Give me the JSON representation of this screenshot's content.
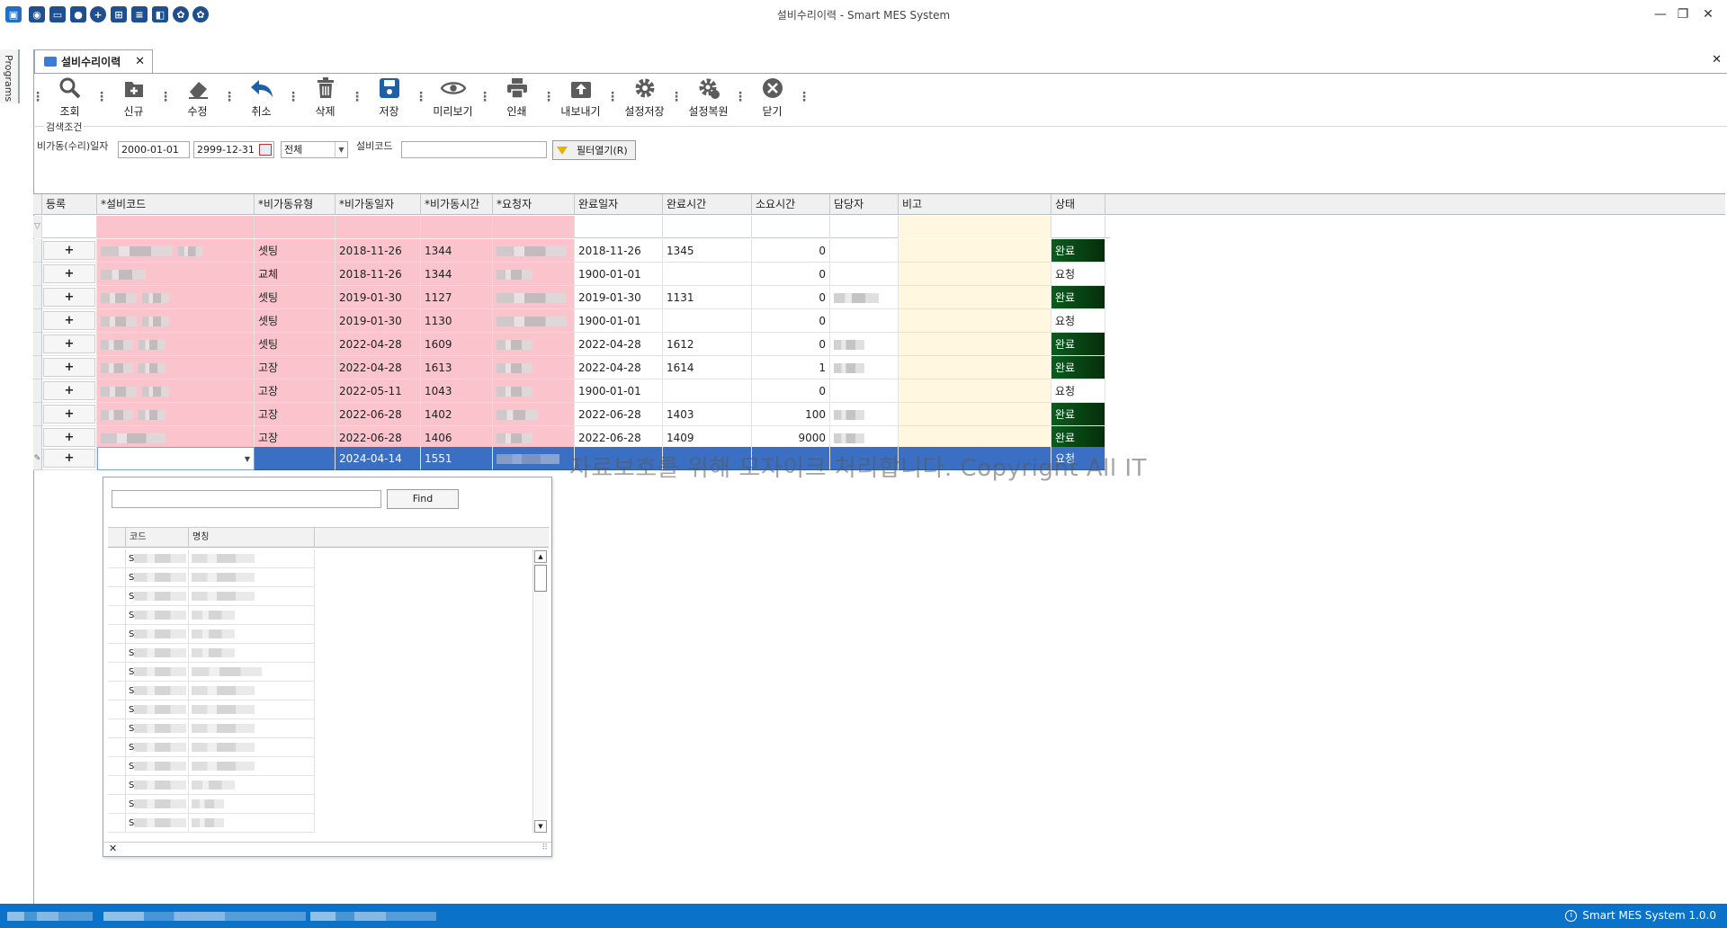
{
  "window": {
    "title": "설비수리이력 - Smart MES System",
    "minimize_glyph": "—",
    "restore_glyph": "❐",
    "close_glyph": "✕"
  },
  "left_strip": {
    "label": "Programs"
  },
  "document_tab": {
    "label": "설비수리이력",
    "close_glyph": "✕",
    "close_all_glyph": "✕"
  },
  "toolbar": {
    "buttons": [
      {
        "label": "조회",
        "icon": "search-icon"
      },
      {
        "label": "신규",
        "icon": "new-icon"
      },
      {
        "label": "수정",
        "icon": "eraser-icon"
      },
      {
        "label": "취소",
        "icon": "undo-icon"
      },
      {
        "label": "삭제",
        "icon": "trash-icon"
      },
      {
        "label": "저장",
        "icon": "save-icon"
      },
      {
        "label": "미리보기",
        "icon": "eye-icon"
      },
      {
        "label": "인쇄",
        "icon": "printer-icon"
      },
      {
        "label": "내보내기",
        "icon": "export-icon"
      },
      {
        "label": "설정저장",
        "icon": "gear-icon"
      },
      {
        "label": "설정복원",
        "icon": "gear-restore-icon"
      },
      {
        "label": "닫기",
        "icon": "close-circle-icon"
      }
    ]
  },
  "search": {
    "legend": "검색조건",
    "date_label": "비가동(수리)일자",
    "date_from": "2000-01-01",
    "date_to": "2999-12-31",
    "type_value": "전체",
    "code_label": "설비코드",
    "code_value": "",
    "filter_button": "필터열기(R)"
  },
  "grid": {
    "columns": [
      "등록",
      "*설비코드",
      "*비가동유형",
      "*비가동일자",
      "*비가동시간",
      "*요청자",
      "완료일자",
      "완료시간",
      "소요시간",
      "담당자",
      "비고",
      "상태"
    ],
    "plus_glyph": "+",
    "rows": [
      {
        "type": "셋팅",
        "date": "2018-11-26",
        "time": "1344",
        "done_date": "2018-11-26",
        "done_time": "1345",
        "duration": "0",
        "status": "완료"
      },
      {
        "type": "교체",
        "date": "2018-11-26",
        "time": "1344",
        "done_date": "1900-01-01",
        "done_time": "",
        "duration": "0",
        "status": "요청"
      },
      {
        "type": "셋팅",
        "date": "2019-01-30",
        "time": "1127",
        "done_date": "2019-01-30",
        "done_time": "1131",
        "duration": "0",
        "status": "완료"
      },
      {
        "type": "셋팅",
        "date": "2019-01-30",
        "time": "1130",
        "done_date": "1900-01-01",
        "done_time": "",
        "duration": "0",
        "status": "요청"
      },
      {
        "type": "셋팅",
        "date": "2022-04-28",
        "time": "1609",
        "done_date": "2022-04-28",
        "done_time": "1612",
        "duration": "0",
        "status": "완료"
      },
      {
        "type": "고장",
        "date": "2022-04-28",
        "time": "1613",
        "done_date": "2022-04-28",
        "done_time": "1614",
        "duration": "1",
        "status": "완료"
      },
      {
        "type": "고장",
        "date": "2022-05-11",
        "time": "1043",
        "done_date": "1900-01-01",
        "done_time": "",
        "duration": "0",
        "status": "요청"
      },
      {
        "type": "고장",
        "date": "2022-06-28",
        "time": "1402",
        "done_date": "2022-06-28",
        "done_time": "1403",
        "duration": "100",
        "status": "완료"
      },
      {
        "type": "고장",
        "date": "2022-06-28",
        "time": "1406",
        "done_date": "2022-06-28",
        "done_time": "1409",
        "duration": "9000",
        "status": "완료"
      }
    ],
    "new_row": {
      "date": "2024-04-14",
      "time": "1551",
      "status": "요청"
    },
    "watermark": "자료보호를 위해 모자이크 처리합니다. Copyright All IT"
  },
  "popup": {
    "find_button": "Find",
    "columns": [
      "코드",
      "명칭"
    ],
    "row_prefix": "S",
    "close_glyph": "✕"
  },
  "statusbar": {
    "app_version": "Smart MES System 1.0.0",
    "info_glyph": "i"
  },
  "colors": {
    "required_cell": "#fbc4cc",
    "note_cell": "#fff7df",
    "selected_row": "#3a6fc4",
    "status_done": "#0c5c1e",
    "statusbar": "#0a73c9"
  }
}
